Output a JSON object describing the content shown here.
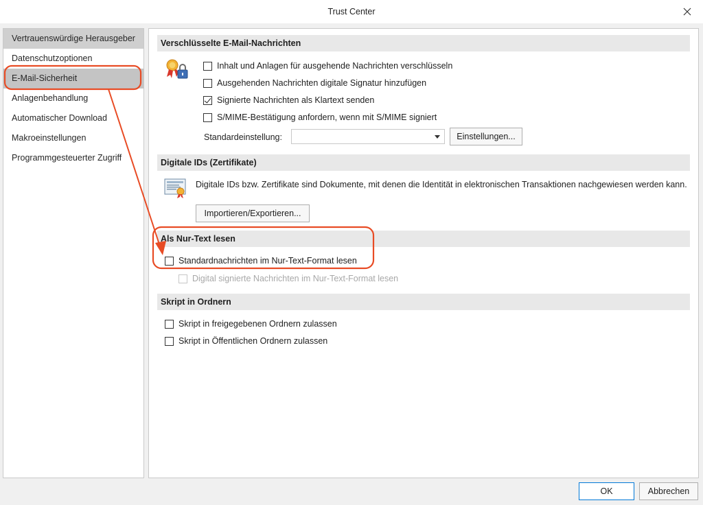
{
  "window": {
    "title": "Trust Center",
    "close_glyph": "✕"
  },
  "sidebar": {
    "items": [
      {
        "label": "Vertrauenswürdige Herausgeber",
        "state": "hover"
      },
      {
        "label": "Datenschutzoptionen",
        "state": ""
      },
      {
        "label": "E-Mail-Sicherheit",
        "state": "active"
      },
      {
        "label": "Anlagenbehandlung",
        "state": ""
      },
      {
        "label": "Automatischer Download",
        "state": ""
      },
      {
        "label": "Makroeinstellungen",
        "state": ""
      },
      {
        "label": "Programmgesteuerter Zugriff",
        "state": ""
      }
    ]
  },
  "encrypted": {
    "title": "Verschlüsselte E-Mail-Nachrichten",
    "options": [
      {
        "label": "Inhalt und Anlagen für ausgehende Nachrichten verschlüsseln",
        "checked": false
      },
      {
        "label": "Ausgehenden Nachrichten digitale Signatur hinzufügen",
        "checked": false
      },
      {
        "label": "Signierte Nachrichten als Klartext senden",
        "checked": true
      },
      {
        "label": "S/MIME-Bestätigung anfordern, wenn mit S/MIME signiert",
        "checked": false
      }
    ],
    "default_setting_label": "Standardeinstellung:",
    "default_setting_value": "",
    "settings_button": "Einstellungen..."
  },
  "digital_ids": {
    "title": "Digitale IDs (Zertifikate)",
    "description": "Digitale IDs bzw. Zertifikate sind Dokumente, mit denen die Identität in elektronischen Transaktionen nachgewiesen werden kann.",
    "import_export_button": "Importieren/Exportieren..."
  },
  "plain_text": {
    "title": "Als Nur-Text lesen",
    "read_plain_label": "Standardnachrichten im Nur-Text-Format lesen",
    "read_plain_checked": false,
    "read_signed_plain_label": "Digital signierte Nachrichten im Nur-Text-Format lesen",
    "read_signed_plain_checked": false
  },
  "script_folders": {
    "title": "Skript in Ordnern",
    "shared_label": "Skript in freigegebenen Ordnern zulassen",
    "shared_checked": false,
    "public_label": "Skript in Öffentlichen Ordnern zulassen",
    "public_checked": false
  },
  "footer": {
    "ok": "OK",
    "cancel": "Abbrechen"
  },
  "annotation": {
    "color": "#e84b24"
  },
  "icons": {
    "encryption": "certificate-lock-icon",
    "certificate": "certificate-document-icon"
  }
}
